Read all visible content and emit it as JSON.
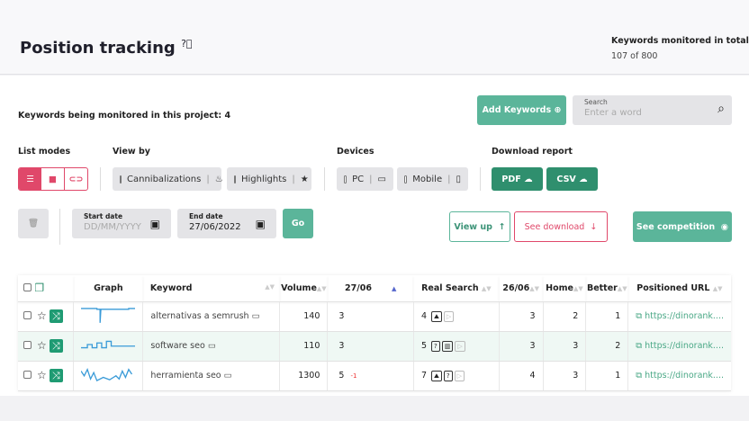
{
  "header": {
    "title": "Position tracking",
    "help_icon": "question-circle-icon",
    "total_label": "Keywords monitored in total",
    "total_value": "107 of 800"
  },
  "project": {
    "monitored_label": "Keywords being monitored in this project: 4"
  },
  "add_keywords": "Add Keywords",
  "search": {
    "label": "Search",
    "placeholder": "Enter a word"
  },
  "sections": {
    "list_modes": "List modes",
    "view_by": "View by",
    "devices": "Devices",
    "download": "Download report"
  },
  "view_by": [
    {
      "label": "Cannibalizations"
    },
    {
      "label": "Highlights"
    }
  ],
  "devices": [
    {
      "label": "PC"
    },
    {
      "label": "Mobile"
    }
  ],
  "download": {
    "pdf": "PDF",
    "csv": "CSV"
  },
  "dates": {
    "start_label": "Start date",
    "start_placeholder": "DD/MM/YYYY",
    "end_label": "End date",
    "end_value": "27/06/2022",
    "go": "Go"
  },
  "actions": {
    "view_up": "View up",
    "see_download": "See download",
    "see_competition": "See competition"
  },
  "colors": {
    "accent": "#5bb59a",
    "dark_green": "#2f8f6e",
    "pink": "#e0486a"
  },
  "table": {
    "headers": {
      "graph": "Graph",
      "keyword": "Keyword",
      "volume": "Volume",
      "d1": "27/06",
      "real": "Real Search",
      "d2": "26/06",
      "home": "Home",
      "better": "Better",
      "url": "Positioned URL"
    },
    "rows": [
      {
        "keyword": "alternativas a semrush",
        "volume": "140",
        "pos": "3",
        "change": "",
        "real": "4",
        "features": [
          "image",
          "video"
        ],
        "prev": "3",
        "home": "2",
        "better": "1",
        "url": "https://dinorank...."
      },
      {
        "keyword": "software seo",
        "volume": "110",
        "pos": "3",
        "change": "",
        "real": "5",
        "features": [
          "question",
          "building",
          "video"
        ],
        "prev": "3",
        "home": "3",
        "better": "2",
        "url": "https://dinorank...."
      },
      {
        "keyword": "herramienta seo",
        "volume": "1300",
        "pos": "5",
        "change": "-1",
        "real": "7",
        "features": [
          "image",
          "question",
          "video"
        ],
        "prev": "4",
        "home": "3",
        "better": "1",
        "url": "https://dinorank...."
      }
    ]
  }
}
